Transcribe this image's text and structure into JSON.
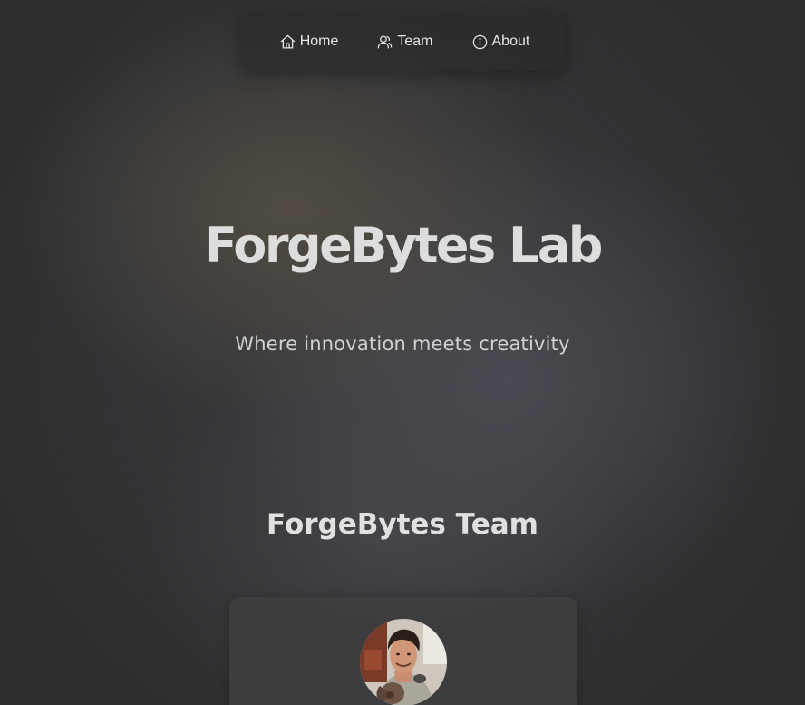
{
  "nav": {
    "items": [
      {
        "label": "Home",
        "icon": "home-icon"
      },
      {
        "label": "Team",
        "icon": "users-icon"
      },
      {
        "label": "About",
        "icon": "info-icon"
      }
    ]
  },
  "hero": {
    "title": "ForgeBytes Lab",
    "subtitle": "Where innovation meets creativity"
  },
  "team_section": {
    "title": "ForgeBytes Team",
    "members": [
      {
        "avatar": "member-avatar-photo"
      }
    ]
  },
  "colors": {
    "background": "#2d2d2f",
    "text": "#dddddd",
    "card": "#3e3e40"
  }
}
